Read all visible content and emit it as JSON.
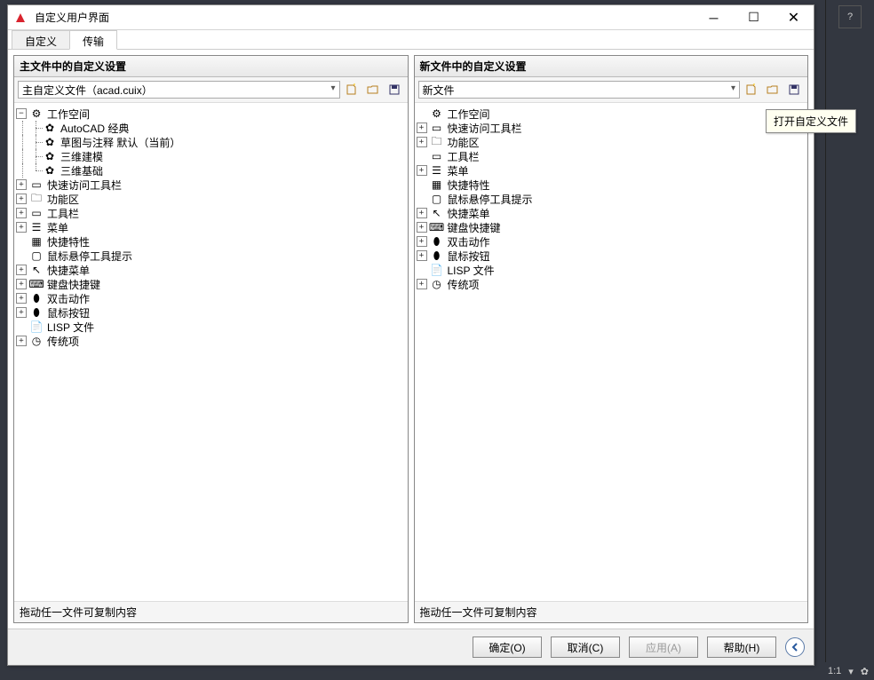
{
  "window": {
    "title": "自定义用户界面"
  },
  "tabs": {
    "tab1": "自定义",
    "tab2": "传输"
  },
  "left_panel": {
    "header": "主文件中的自定义设置",
    "combo": "主自定义文件（acad.cuix）",
    "footer": "拖动任一文件可复制内容",
    "tree": {
      "workspace": "工作空间",
      "ws_autocad": "AutoCAD 经典",
      "ws_sketch": "草图与注释  默认（当前）",
      "ws_3dmodel": "三维建模",
      "ws_3dbasic": "三维基础",
      "quickaccess": "快速访问工具栏",
      "ribbon": "功能区",
      "toolbars": "工具栏",
      "menus": "菜单",
      "properties": "快捷特性",
      "rollover": "鼠标悬停工具提示",
      "shortcut_menus": "快捷菜单",
      "keyboard": "键盘快捷键",
      "doubleclick": "双击动作",
      "mousebuttons": "鼠标按钮",
      "lisp": "LISP 文件",
      "legacy": "传统项"
    }
  },
  "right_panel": {
    "header": "新文件中的自定义设置",
    "combo": "新文件",
    "footer": "拖动任一文件可复制内容",
    "tree": {
      "workspace": "工作空间",
      "quickaccess": "快速访问工具栏",
      "ribbon": "功能区",
      "toolbars": "工具栏",
      "menus": "菜单",
      "properties": "快捷特性",
      "rollover": "鼠标悬停工具提示",
      "shortcut_menus": "快捷菜单",
      "keyboard": "键盘快捷键",
      "doubleclick": "双击动作",
      "mousebuttons": "鼠标按钮",
      "lisp": "LISP 文件",
      "legacy": "传统项"
    }
  },
  "buttons": {
    "ok": "确定(O)",
    "cancel": "取消(C)",
    "apply": "应用(A)",
    "help": "帮助(H)"
  },
  "tooltip": "打开自定义文件",
  "statusbar": {
    "ratio": "1:1"
  }
}
